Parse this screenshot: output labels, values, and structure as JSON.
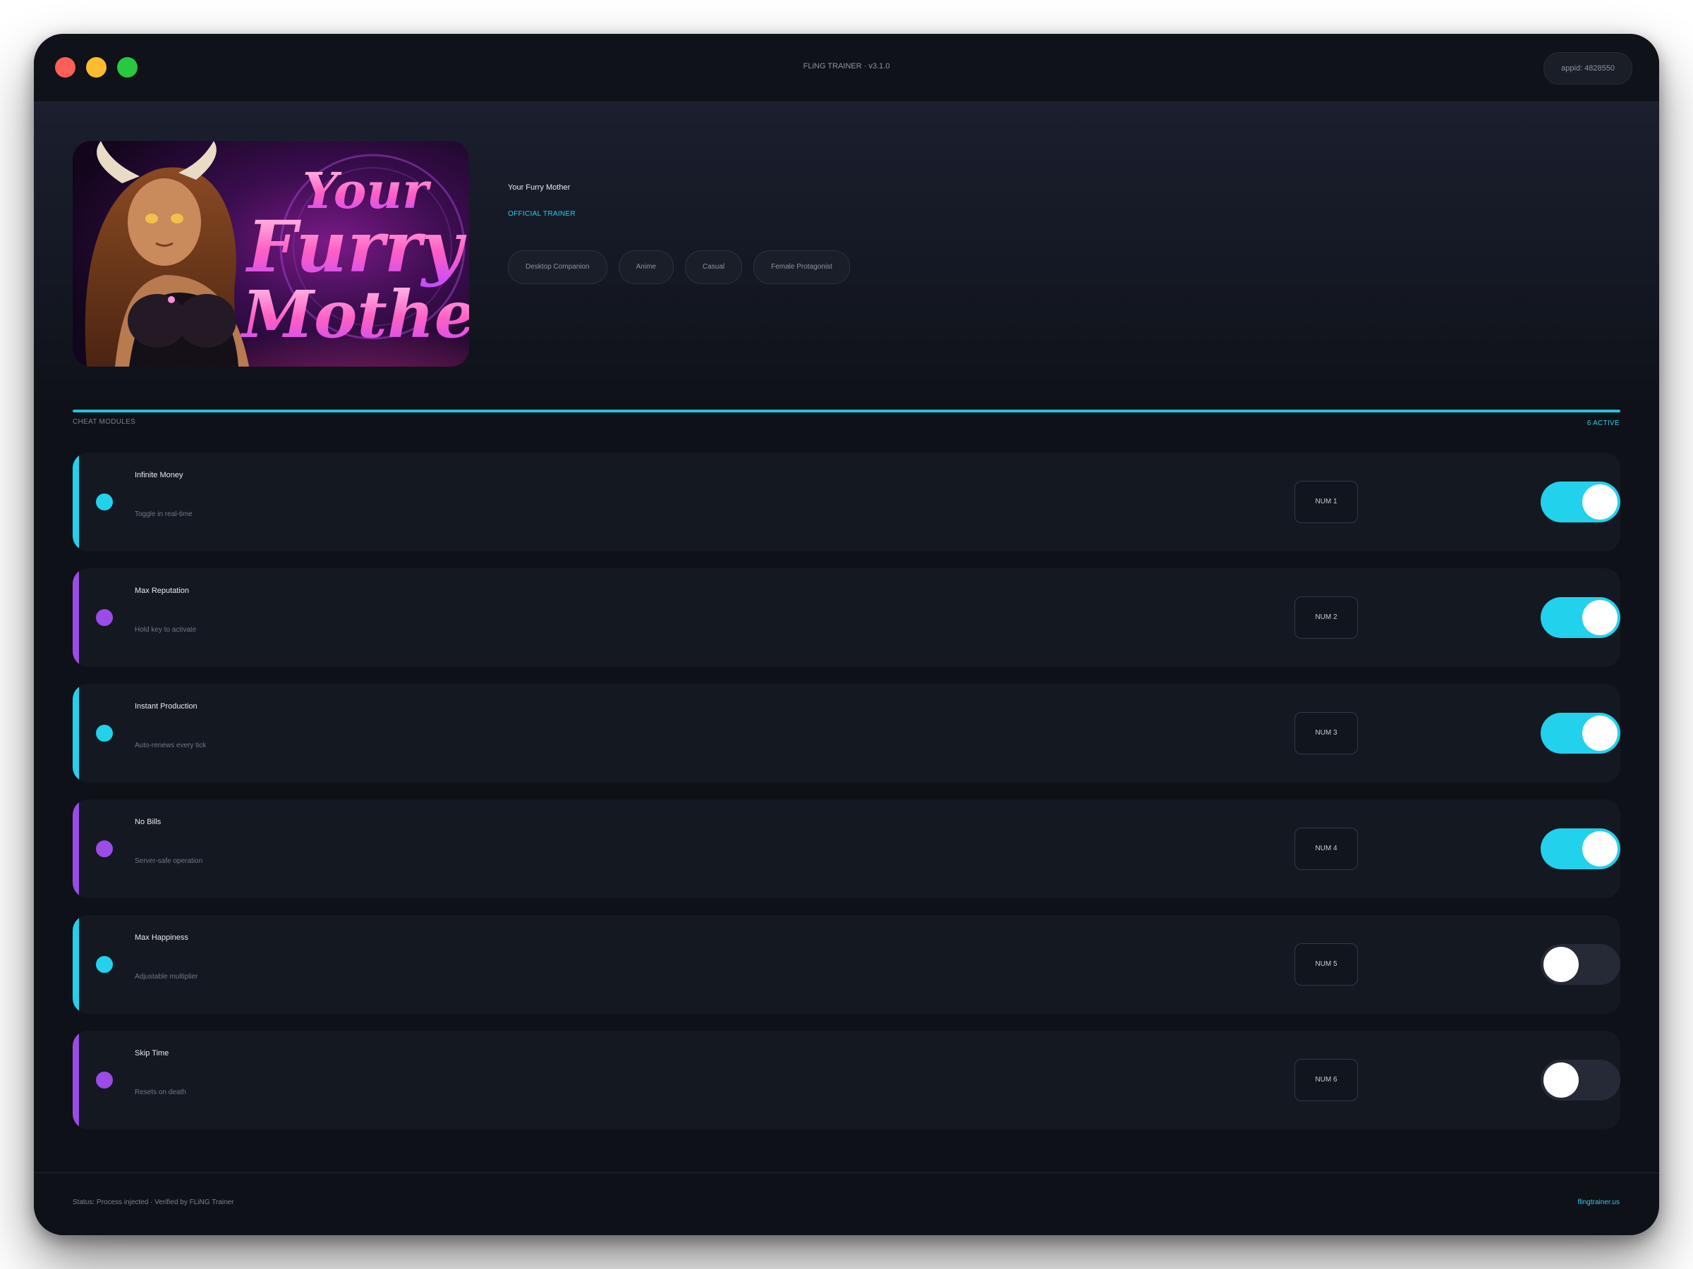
{
  "window": {
    "title": "FLiNG TRAINER · v3.1.0",
    "appid": "appid: 4828550"
  },
  "game": {
    "title": "Your Furry Mother",
    "subtitle": "OFFICIAL TRAINER",
    "cover_text": [
      "Your",
      "Furry",
      "Mother"
    ],
    "tags": [
      "Desktop Companion",
      "Anime",
      "Casual",
      "Female Protagonist"
    ]
  },
  "modules": {
    "label": "CHEAT MODULES",
    "active_count": "6 ACTIVE",
    "items": [
      {
        "name": "Infinite Money",
        "desc": "Toggle in real-time",
        "key": "NUM 1",
        "enabled": true,
        "accent": "#22d1ec"
      },
      {
        "name": "Max Reputation",
        "desc": "Hold key to activate",
        "key": "NUM 2",
        "enabled": true,
        "accent": "#9b4be6"
      },
      {
        "name": "Instant Production",
        "desc": "Auto-renews every tick",
        "key": "NUM 3",
        "enabled": true,
        "accent": "#22d1ec"
      },
      {
        "name": "No Bills",
        "desc": "Server-safe operation",
        "key": "NUM 4",
        "enabled": true,
        "accent": "#9b4be6"
      },
      {
        "name": "Max Happiness",
        "desc": "Adjustable multiplier",
        "key": "NUM 5",
        "enabled": false,
        "accent": "#22d1ec"
      },
      {
        "name": "Skip Time",
        "desc": "Resets on death",
        "key": "NUM 6",
        "enabled": false,
        "accent": "#9b4be6"
      }
    ]
  },
  "footer": {
    "status": "Status: Process injected · Verified by FLiNG Trainer",
    "site": "flingtrainer.us"
  },
  "colors": {
    "accent_cyan": "#22d1ec",
    "accent_purple": "#9b4be6",
    "background": "#0e1117"
  }
}
